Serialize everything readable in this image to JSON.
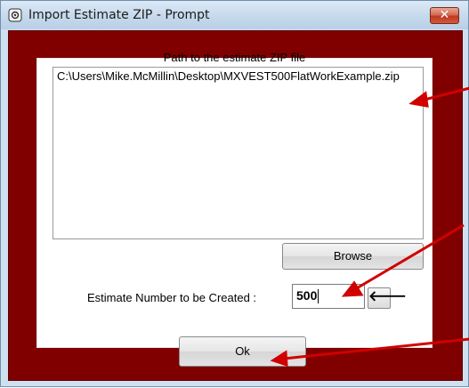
{
  "window": {
    "title": "Import Estimate ZIP - Prompt",
    "title_icon": "gear-prompt-icon",
    "close_label": "✕"
  },
  "form": {
    "path_label": "Path to the estimate ZIP file",
    "path_value": "C:\\Users\\Mike.McMillin\\Desktop\\MXVEST500FlatWorkExample.zip",
    "browse_label": "Browse",
    "estimate_label": "Estimate Number to be Created :",
    "estimate_value": "500",
    "arrow_label": "🡐",
    "ok_label": "Ok"
  },
  "colors": {
    "client_background": "#800000",
    "annotation_arrows": "#d10000"
  }
}
